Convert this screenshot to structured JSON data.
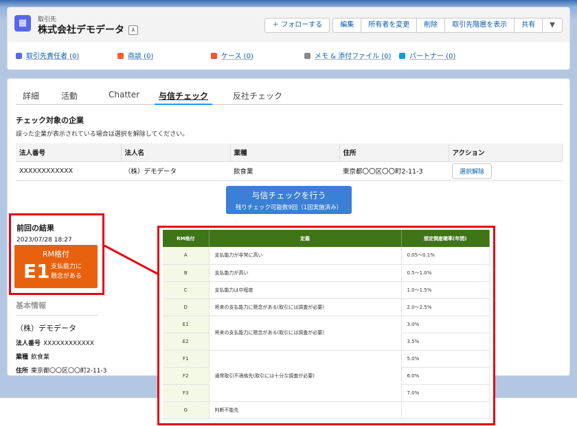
{
  "header": {
    "object_type": "取引先",
    "account_name": "株式会社デモデータ",
    "hierarchy_icon": "hierarchy-icon",
    "follow": "＋ フォローする",
    "actions": [
      "編集",
      "所有者を変更",
      "削除",
      "取引先階層を表示",
      "共有"
    ],
    "more": "▼"
  },
  "related": [
    {
      "label": "取引先責任者 (0)",
      "color": "#5867e8"
    },
    {
      "label": "商談 (0)",
      "color": "#ff5d2d"
    },
    {
      "label": "ケース (0)",
      "color": "#f2542d"
    },
    {
      "label": "メモ & 添付ファイル (0)",
      "color": "#7f8de1"
    },
    {
      "label": "パートナー (0)",
      "color": "#0d9dda"
    }
  ],
  "tabs": [
    "詳細",
    "活動",
    "Chatter",
    "与信チェック",
    "反社チェック"
  ],
  "active_tab": "与信チェック",
  "check": {
    "title": "チェック対象の企業",
    "description": "誤った企業が表示されている場合は選択を解除してください。",
    "columns": [
      "法人番号",
      "法人名",
      "業種",
      "住所",
      "アクション"
    ],
    "row": {
      "corp_no": "XXXXXXXXXXXX",
      "name": "（株）デモデータ",
      "industry": "飲食業",
      "address": "東京都〇〇区〇〇町2-11-3",
      "action": "選択解除"
    },
    "button": "与信チェックを行う",
    "button_sub": "残りチェック可能数9回（1回実施済み）"
  },
  "result": {
    "title": "前回の結果",
    "datetime": "2023/07/28 18:27",
    "label": "RM格付",
    "grade": "E1",
    "desc1": "支払能力に",
    "desc2": "懸念がある"
  },
  "basic": {
    "title": "基本情報",
    "name": "（株）デモデータ",
    "corp_no_label": "法人番号",
    "corp_no": "XXXXXXXXXXXX",
    "industry_label": "業種",
    "industry": "飲食業",
    "address_label": "住所",
    "address": "東京都〇〇区〇〇町2-11-3"
  },
  "rm_table": {
    "columns": [
      "RM格付",
      "定義",
      "想定倒産確率(年間)"
    ],
    "rows": [
      {
        "grade": "A",
        "def": "支払能力が非常に高い",
        "prob": "0.05～0.1%"
      },
      {
        "grade": "B",
        "def": "支払能力が高い",
        "prob": "0.5～1.0%"
      },
      {
        "grade": "C",
        "def": "支払能力は中程度",
        "prob": "1.0～1.5%"
      },
      {
        "grade": "D",
        "def": "将来の支払能力に懸念がある(取引には調査が必要)",
        "prob": "2.0～2.5%"
      },
      {
        "grade": "E1",
        "def": "将来の支払能力に懸念がある(取引には調査が必要)",
        "prob": "3.0%"
      },
      {
        "grade": "E2",
        "def": "",
        "prob": "3.5%"
      },
      {
        "grade": "F1",
        "def": "通常取引不適格先(取引には十分な調査が必要)",
        "prob": "5.0%"
      },
      {
        "grade": "F2",
        "def": "",
        "prob": "6.0%"
      },
      {
        "grade": "F3",
        "def": "",
        "prob": "7.0%"
      },
      {
        "grade": "G",
        "def": "判断不能先",
        "prob": ""
      }
    ]
  }
}
